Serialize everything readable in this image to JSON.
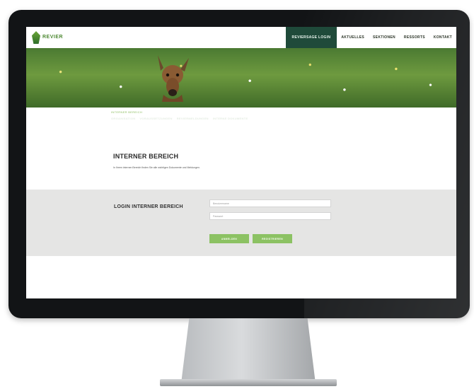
{
  "header": {
    "logo_text": "REVIER",
    "logo_sub": "",
    "nav": [
      {
        "label": "REVIERSAGE LOGIN",
        "active": true
      },
      {
        "label": "AKTUELLES",
        "active": false
      },
      {
        "label": "SEKTIONEN",
        "active": false
      },
      {
        "label": "RESSORTS",
        "active": false
      },
      {
        "label": "KONTAKT",
        "active": false
      }
    ]
  },
  "hero": {
    "breadcrumb": "INTERNER BEREICH",
    "subnav": [
      "ORGANISATION",
      "VORAUSSETZUNGEN",
      "REVIERMELDUNGEN",
      "INTERNE DOKUMENTE"
    ]
  },
  "content": {
    "title": "INTERNER BEREICH",
    "intro": "In Ihrem internen Bereich finden Sie alle wichtigen Dokumente und Meldungen."
  },
  "login": {
    "title": "LOGIN INTERNER BEREICH",
    "username_placeholder": "Benutzername",
    "password_placeholder": "Passwort",
    "submit_label": "ANMELDEN",
    "register_label": "REGISTRIEREN"
  },
  "colors": {
    "nav_active_bg": "#1f4a3a",
    "button_green": "#8cc263",
    "login_band": "#e5e5e4"
  }
}
